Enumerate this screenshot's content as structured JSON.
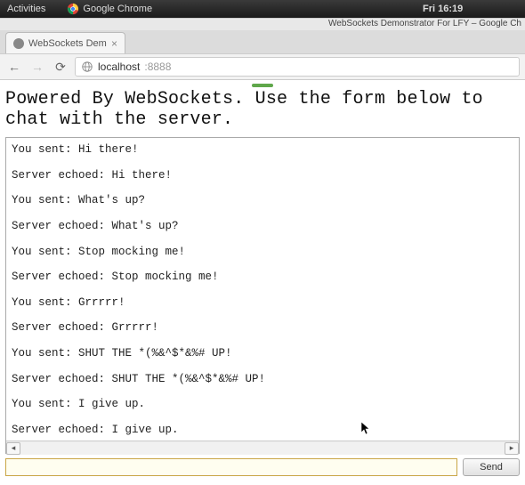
{
  "topbar": {
    "activities_label": "Activities",
    "app_label": "Google Chrome",
    "time_label": "Fri 16:19"
  },
  "browser": {
    "window_title": "WebSockets Demonstrator For LFY – Google Ch",
    "tab_title": "WebSockets Demonstrato",
    "nav": {
      "back_glyph": "←",
      "forward_glyph": "→",
      "reload_glyph": "⟳",
      "menu_glyph": "≡"
    },
    "url": {
      "host": "localhost",
      "port": ":8888"
    }
  },
  "page": {
    "heading": "Powered By WebSockets. Use the form below to chat with the server.",
    "messages": [
      "You sent: Hi there!",
      "Server echoed: Hi there!",
      "You sent: What's up?",
      "Server echoed: What's up?",
      "You sent: Stop mocking me!",
      "Server echoed: Stop mocking me!",
      "You sent: Grrrrr!",
      "Server echoed: Grrrrr!",
      "You sent: SHUT THE *(%&^$*&%# UP!",
      "Server echoed: SHUT THE *(%&^$*&%# UP!",
      "You sent: I give up.",
      "Server echoed: I give up."
    ],
    "input_value": "",
    "send_label": "Send",
    "hscroll_left": "◂",
    "hscroll_right": "▸"
  }
}
